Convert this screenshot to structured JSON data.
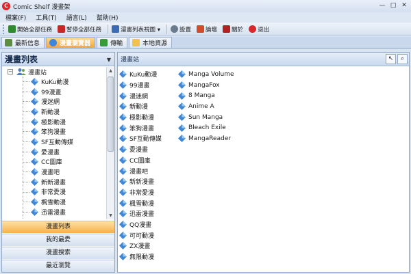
{
  "window": {
    "title": "Comic  Shelf 漫畫架",
    "min": "—",
    "max": "□",
    "close": "✕"
  },
  "menu": [
    "檔案(F)",
    "工具(T)",
    "語言(L)",
    "幫助(H)"
  ],
  "toolbar": [
    {
      "label": "開始全部任務",
      "icon": "play-icon",
      "color": "#2f8a2f"
    },
    {
      "label": "暫停全部任務",
      "icon": "pause-icon",
      "color": "#c62828"
    },
    {
      "label": "漫畫列表視圖 ▾",
      "icon": "list-view-icon",
      "color": "#3d6bb3"
    },
    {
      "label": "設置",
      "icon": "settings-icon",
      "color": "#6b7b8c"
    },
    {
      "label": "論壇",
      "icon": "forum-icon",
      "color": "#d24b2a"
    },
    {
      "label": "關於",
      "icon": "about-icon",
      "color": "#b22222"
    },
    {
      "label": "退出",
      "icon": "exit-icon",
      "color": "#d8262b"
    }
  ],
  "tabs": [
    {
      "label": "最新信息",
      "icon": "news-icon",
      "active": false
    },
    {
      "label": "漫畫瀏覽器",
      "icon": "browser-icon",
      "active": true
    },
    {
      "label": "傳輸",
      "icon": "transfer-icon",
      "active": false
    },
    {
      "label": "本地資源",
      "icon": "folder-icon",
      "active": false
    }
  ],
  "left_panel": {
    "title": "漫畫列表",
    "tree_root": "漫畫站",
    "tree_items": [
      "KuKu動漫",
      "99漫畫",
      "漫迷網",
      "新動漫",
      "極影動漫",
      "笨狗漫畫",
      "SF互動傳媒",
      "愛漫畫",
      "CC圖庫",
      "漫畫吧",
      "新新漫畫",
      "非常愛漫",
      "楓雪動漫",
      "迅雷漫畫"
    ],
    "nav_buttons": [
      "漫畫列表",
      "我的最愛",
      "漫畫搜索",
      "最近瀏覽"
    ]
  },
  "right_panel": {
    "breadcrumb": "漫畫站",
    "col1": [
      "KuKu動漫",
      "99漫畫",
      "漫迷網",
      "新動漫",
      "極影動漫",
      "笨狗漫畫",
      "SF互動傳媒",
      "愛漫畫",
      "CC圖庫",
      "漫畫吧",
      "新新漫畫",
      "非常愛漫",
      "楓雪動漫",
      "迅雷漫畫",
      "QQ漫畫",
      "可可動漫",
      "ZX漫畫",
      "無限動漫"
    ],
    "col2": [
      "Manga Volume",
      "MangaFox",
      "8 Manga",
      "Anime A",
      "Sun Manga",
      "Bleach Exile",
      "MangaReader"
    ]
  },
  "colors": {
    "accent_orange": "#f4a63c",
    "frame_blue": "#8ea6c8",
    "item_icon_blue": "#3f86d6"
  }
}
